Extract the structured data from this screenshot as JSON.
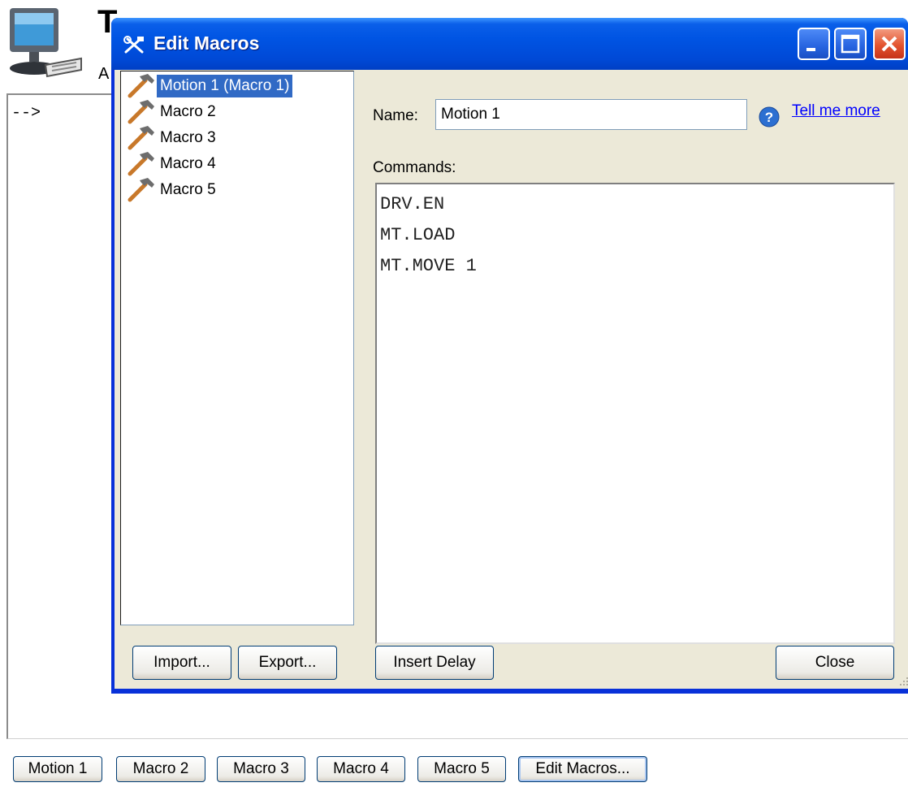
{
  "terminal": {
    "title": "T",
    "subtitle": "A",
    "prompt": "-->"
  },
  "macro_bar": {
    "buttons": [
      "Motion 1",
      "Macro 2",
      "Macro 3",
      "Macro 4",
      "Macro 5",
      "Edit Macros..."
    ]
  },
  "dialog": {
    "title": "Edit Macros",
    "title_icon": "tools-icon",
    "window_controls": [
      "minimize-icon",
      "maximize-icon",
      "close-icon"
    ],
    "macros": [
      {
        "label": "Motion 1 (Macro 1)",
        "icon": "hammer-icon",
        "selected": true
      },
      {
        "label": "Macro 2",
        "icon": "hammer-icon",
        "selected": false
      },
      {
        "label": "Macro 3",
        "icon": "hammer-icon",
        "selected": false
      },
      {
        "label": "Macro 4",
        "icon": "hammer-icon",
        "selected": false
      },
      {
        "label": "Macro 5",
        "icon": "hammer-icon",
        "selected": false
      }
    ],
    "name_label": "Name:",
    "name_value": "Motion 1",
    "help_link": "Tell me more",
    "commands_label": "Commands:",
    "commands": [
      "DRV.EN",
      "MT.LOAD",
      "MT.MOVE 1"
    ],
    "buttons": {
      "import": "Import...",
      "export": "Export...",
      "insert_delay": "Insert Delay",
      "close": "Close"
    }
  },
  "colors": {
    "titlebar": "#0054e3",
    "selection": "#316ac5",
    "dialog_bg": "#ece9d8",
    "link": "#0000ff"
  }
}
